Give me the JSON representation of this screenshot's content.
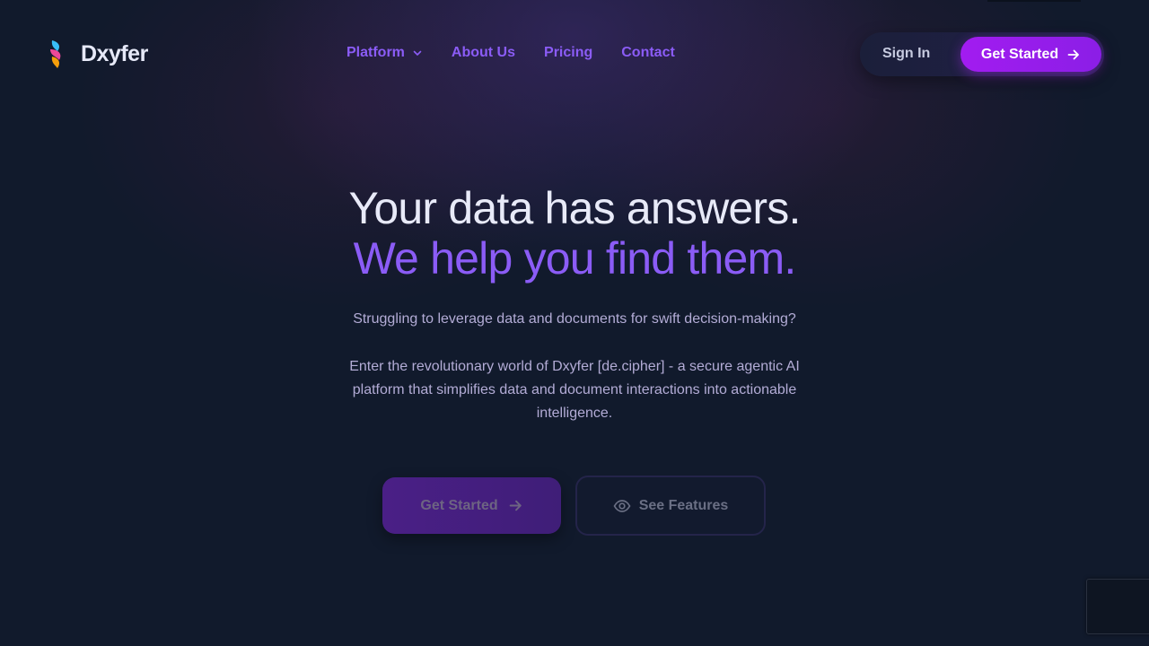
{
  "brand": {
    "name": "Dxyfer",
    "icon": "dxyfer-flame-logo-icon"
  },
  "nav": {
    "items": [
      {
        "label": "Platform",
        "has_dropdown": true
      },
      {
        "label": "About Us"
      },
      {
        "label": "Pricing"
      },
      {
        "label": "Contact"
      }
    ]
  },
  "auth": {
    "signin_label": "Sign In",
    "get_started_label": "Get Started",
    "get_started_icon": "arrow-right-icon"
  },
  "hero": {
    "title_line1": "Your data has answers.",
    "title_line2": "We help you find them.",
    "subtitle": "Struggling to leverage data and documents for swift decision-making?",
    "description": "Enter the revolutionary world of Dxyfer [de.cipher] - a secure agentic AI platform that simplifies data and document interactions into actionable intelligence."
  },
  "cta": {
    "primary_label": "Get Started",
    "primary_icon": "arrow-right-icon",
    "secondary_label": "See Features",
    "secondary_icon": "eye-icon"
  },
  "colors": {
    "background": "#111a2c",
    "accent": "#8b5cf6",
    "button_gradient_start": "#a21cf0",
    "title_text": "#e8eaf8",
    "body_text": "#b3acd6"
  }
}
